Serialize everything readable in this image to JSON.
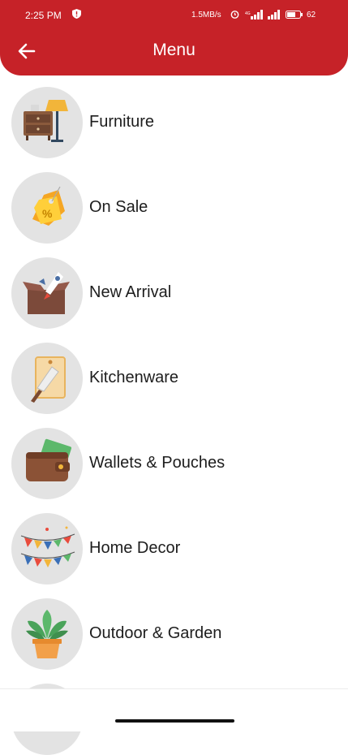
{
  "status_bar": {
    "time": "2:25 PM",
    "speed": "1.5MB/s",
    "battery": "62"
  },
  "header": {
    "title": "Menu",
    "back_icon": "arrow-left-icon",
    "color": "#c62228"
  },
  "menu": {
    "items": [
      {
        "label": "Furniture",
        "icon": "furniture-icon"
      },
      {
        "label": "On Sale",
        "icon": "sale-tag-icon"
      },
      {
        "label": "New Arrival",
        "icon": "new-arrival-box-icon"
      },
      {
        "label": "Kitchenware",
        "icon": "kitchen-knife-icon"
      },
      {
        "label": "Wallets & Pouches",
        "icon": "wallet-icon"
      },
      {
        "label": "Home Decor",
        "icon": "bunting-flags-icon"
      },
      {
        "label": "Outdoor & Garden",
        "icon": "potted-plant-icon"
      }
    ]
  }
}
